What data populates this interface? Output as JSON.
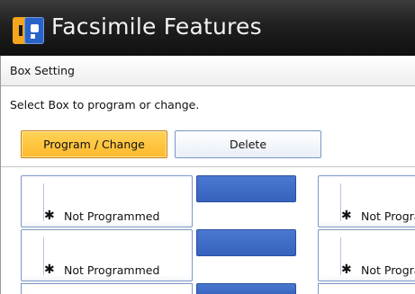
{
  "window": {
    "title": "Facsimile Features"
  },
  "app_icon": "facsimile-features-icon",
  "section": {
    "header": "Box Setting"
  },
  "instruction": "Select Box to program or change.",
  "actions": {
    "program_change": "Program / Change",
    "delete": "Delete"
  },
  "boxes": [
    {
      "mark": "✱",
      "label": "Not Programmed"
    },
    {
      "mark": "✱",
      "label": "Not Programmed"
    },
    {
      "mark": "✱",
      "label": "Not Programmed"
    },
    {
      "mark": "✱",
      "label": "Not Programmed"
    }
  ],
  "colors": {
    "selected_button": "#fdb92c",
    "box_name_field": "#3662bd",
    "title_bar": "#1a1a1a"
  }
}
